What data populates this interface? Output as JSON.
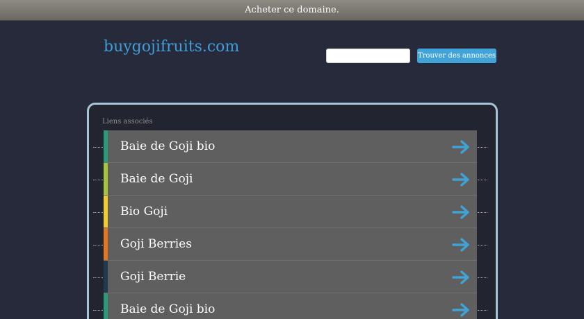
{
  "topbar": {
    "buy_label": "Acheter ce domaine."
  },
  "header": {
    "site_title": "buygojifruits.com"
  },
  "search": {
    "value": "",
    "button_label": "Trouver des annonces"
  },
  "panel": {
    "label": "Liens associés",
    "links": [
      {
        "label": "Baie de Goji bio",
        "color": "#2a9a7a"
      },
      {
        "label": "Baie de Goji",
        "color": "#a6c43c"
      },
      {
        "label": "Bio Goji",
        "color": "#f2cd2a"
      },
      {
        "label": "Goji Berries",
        "color": "#e6761e"
      },
      {
        "label": "Goji Berrie",
        "color": "#1f3b4d"
      },
      {
        "label": "Baie de Goji bio",
        "color": "#2a9a7a"
      }
    ]
  },
  "colors": {
    "accent": "#42a3d8",
    "arrow": "#3fa3d6"
  }
}
